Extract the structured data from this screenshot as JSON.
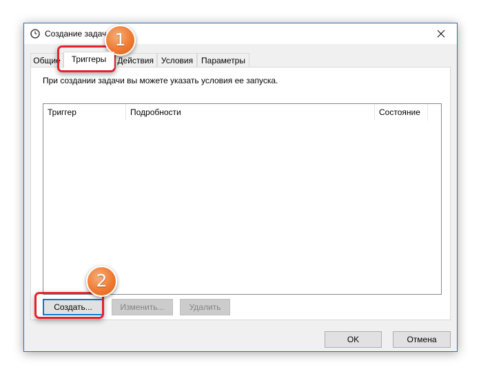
{
  "window": {
    "title": "Создание задачи"
  },
  "tabs": [
    {
      "label": "Общие"
    },
    {
      "label": "Триггеры"
    },
    {
      "label": "Действия"
    },
    {
      "label": "Условия"
    },
    {
      "label": "Параметры"
    }
  ],
  "active_tab": "Триггеры",
  "triggers_tab": {
    "hint": "При создании задачи вы можете указать условия ее запуска.",
    "columns": [
      "Триггер",
      "Подробности",
      "Состояние"
    ],
    "rows": []
  },
  "buttons": {
    "create": "Создать...",
    "edit": "Изменить...",
    "delete": "Удалить"
  },
  "footer": {
    "ok": "OK",
    "cancel": "Отмена"
  },
  "annotations": [
    {
      "number": "1"
    },
    {
      "number": "2"
    }
  ],
  "colors": {
    "highlight": "#e8202a",
    "badge": "#ef7a32",
    "window_border": "#2b6fb6"
  },
  "icons": {
    "title": "clock-icon",
    "close": "close-icon"
  }
}
